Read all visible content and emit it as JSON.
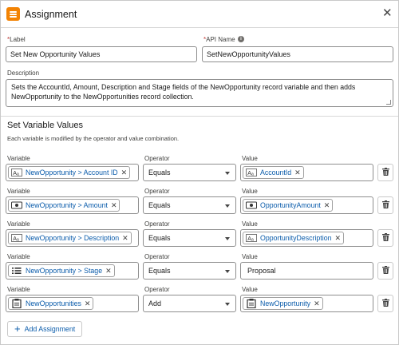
{
  "header": {
    "title": "Assignment",
    "close_glyph": "✕"
  },
  "label_field": {
    "label": "Label",
    "required_mark": "*",
    "value": "Set New Opportunity Values"
  },
  "api_field": {
    "label": "API Name",
    "required_mark": "*",
    "value": "SetNewOpportunityValues",
    "info_icon": "info-icon"
  },
  "description": {
    "label": "Description",
    "value": "Sets the AccountId, Amount, Description and Stage fields of the NewOpportunity record variable and then adds NewOpportunity to the NewOpportunities record collection."
  },
  "section": {
    "title": "Set Variable Values",
    "help": "Each variable is modified by the operator and value combination."
  },
  "column_labels": {
    "variable": "Variable",
    "operator": "Operator",
    "value": "Value"
  },
  "rows": [
    {
      "variable": "NewOpportunity > Account ID",
      "variable_icon": "text-icon",
      "operator": "Equals",
      "value": "AccountId",
      "value_icon": "text-icon",
      "value_is_pill": true
    },
    {
      "variable": "NewOpportunity > Amount",
      "variable_icon": "currency-icon",
      "operator": "Equals",
      "value": "OpportunityAmount",
      "value_icon": "currency-icon",
      "value_is_pill": true
    },
    {
      "variable": "NewOpportunity > Description",
      "variable_icon": "text-icon",
      "operator": "Equals",
      "value": "OpportunityDescription",
      "value_icon": "text-icon",
      "value_is_pill": true
    },
    {
      "variable": "NewOpportunity > Stage",
      "variable_icon": "picklist-icon",
      "operator": "Equals",
      "value": "Proposal",
      "value_icon": "",
      "value_is_pill": false
    },
    {
      "variable": "NewOpportunities",
      "variable_icon": "record-collection-icon",
      "operator": "Add",
      "value": "NewOpportunity",
      "value_icon": "record-icon",
      "value_is_pill": true
    }
  ],
  "pill_remove_glyph": "✕",
  "add_assignment": {
    "label": "Add Assignment",
    "icon": "plus-icon"
  },
  "colors": {
    "header_icon": "#f38303",
    "link_blue": "#0b5cab",
    "border": "#8e8e8e"
  }
}
